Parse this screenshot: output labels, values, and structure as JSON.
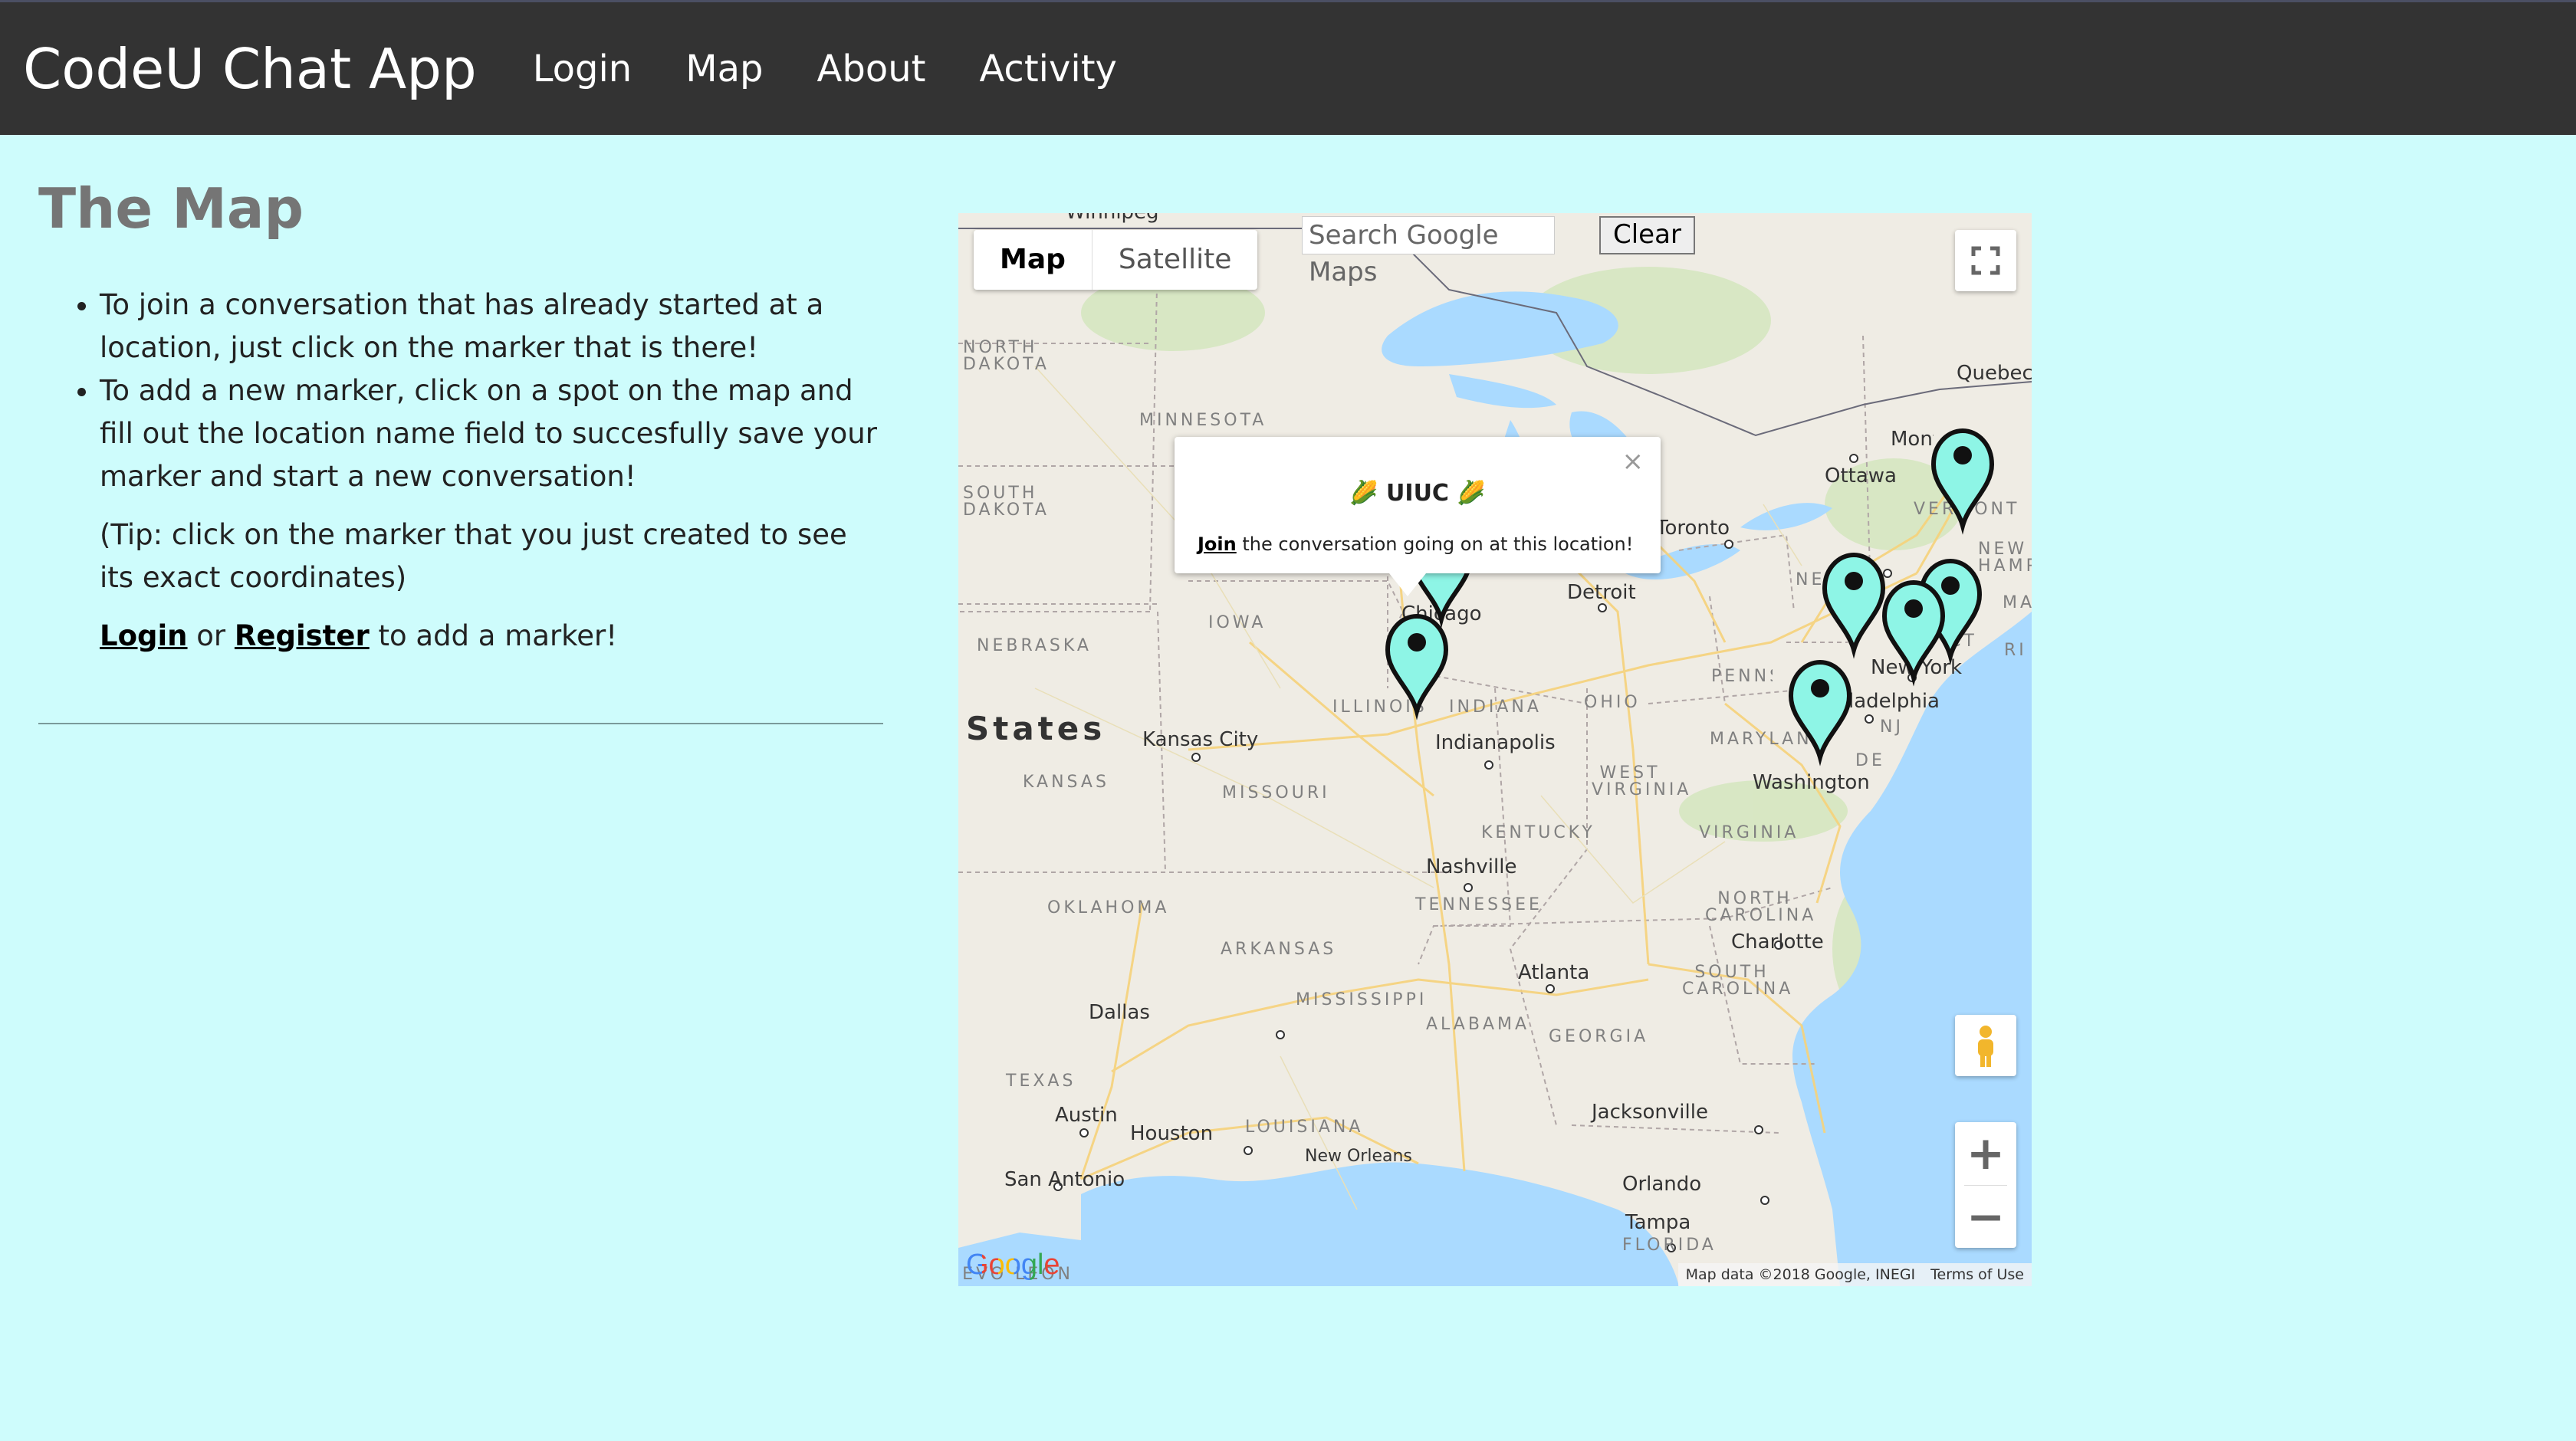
{
  "nav": {
    "title": "CodeU Chat App",
    "links": [
      "Login",
      "Map",
      "About",
      "Activity"
    ]
  },
  "page": {
    "title": "The Map",
    "instructions": [
      "To join a conversation that has already started at a location, just click on the marker that is there!",
      "To add a new marker, click on a spot on the map and fill out the location name field to succesfully save your marker and start a new conversation!"
    ],
    "tip": "(Tip: click on the marker that you just created to see its exact coordinates)",
    "login_link": "Login",
    "or_text": "or",
    "register_link": "Register",
    "login_suffix": "to add a marker!"
  },
  "map": {
    "map_type_buttons": [
      "Map",
      "Satellite"
    ],
    "active_map_type": "Map",
    "search_placeholder": "Search Google Maps",
    "clear_label": "Clear",
    "zoom_in": "+",
    "zoom_out": "−",
    "info_window": {
      "title": "🌽 UIUC 🌽",
      "join_link": "Join",
      "body": "the conversation going on at this location!",
      "close": "×"
    },
    "attribution": "Map data ©2018 Google, INEGI",
    "terms": "Terms of Use",
    "logo": "Google",
    "country_label": "States",
    "state_labels": [
      "NORTH DAKOTA",
      "MINNESOTA",
      "SOUTH DAKOTA",
      "NEBRASKA",
      "IOWA",
      "ILLINOIS",
      "INDIANA",
      "OHIO",
      "KANSAS",
      "MISSOURI",
      "KENTUCKY",
      "WEST VIRGINIA",
      "VIRGINIA",
      "TENNESSEE",
      "NORTH CAROLINA",
      "SOUTH CAROLINA",
      "OKLAHOMA",
      "ARKANSAS",
      "MISSISSIPPI",
      "ALABAMA",
      "GEORGIA",
      "TEXAS",
      "LOUISIANA",
      "FLORIDA",
      "PENNSYLVANIA",
      "MARYLAND",
      "NEW YORK",
      "VERMONT",
      "NEW HAMPSHIRE",
      "MASSACHUSETTS",
      "NJ",
      "DE",
      "CT",
      "RI"
    ],
    "city_labels": [
      "Winnipeg",
      "Quebec",
      "Montreal",
      "Ottawa",
      "Toronto",
      "Detroit",
      "Chicago",
      "Kansas City",
      "Indianapolis",
      "Nashville",
      "Charlotte",
      "Atlanta",
      "Dallas",
      "Austin",
      "Houston",
      "San Antonio",
      "New Orleans",
      "Jacksonville",
      "Orlando",
      "Tampa",
      "Washington",
      "Philadelphia",
      "New York",
      "NUEVO LEON"
    ],
    "markers": [
      "UIUC",
      "Chicago",
      "New York",
      "Boston",
      "Montreal",
      "Philadelphia",
      "Washington"
    ],
    "colors": {
      "land": "#efece4",
      "water": "#aadaff",
      "marker_fill": "#8ef5e6",
      "nav_bg": "#333333",
      "page_bg": "#cefcfc"
    }
  }
}
